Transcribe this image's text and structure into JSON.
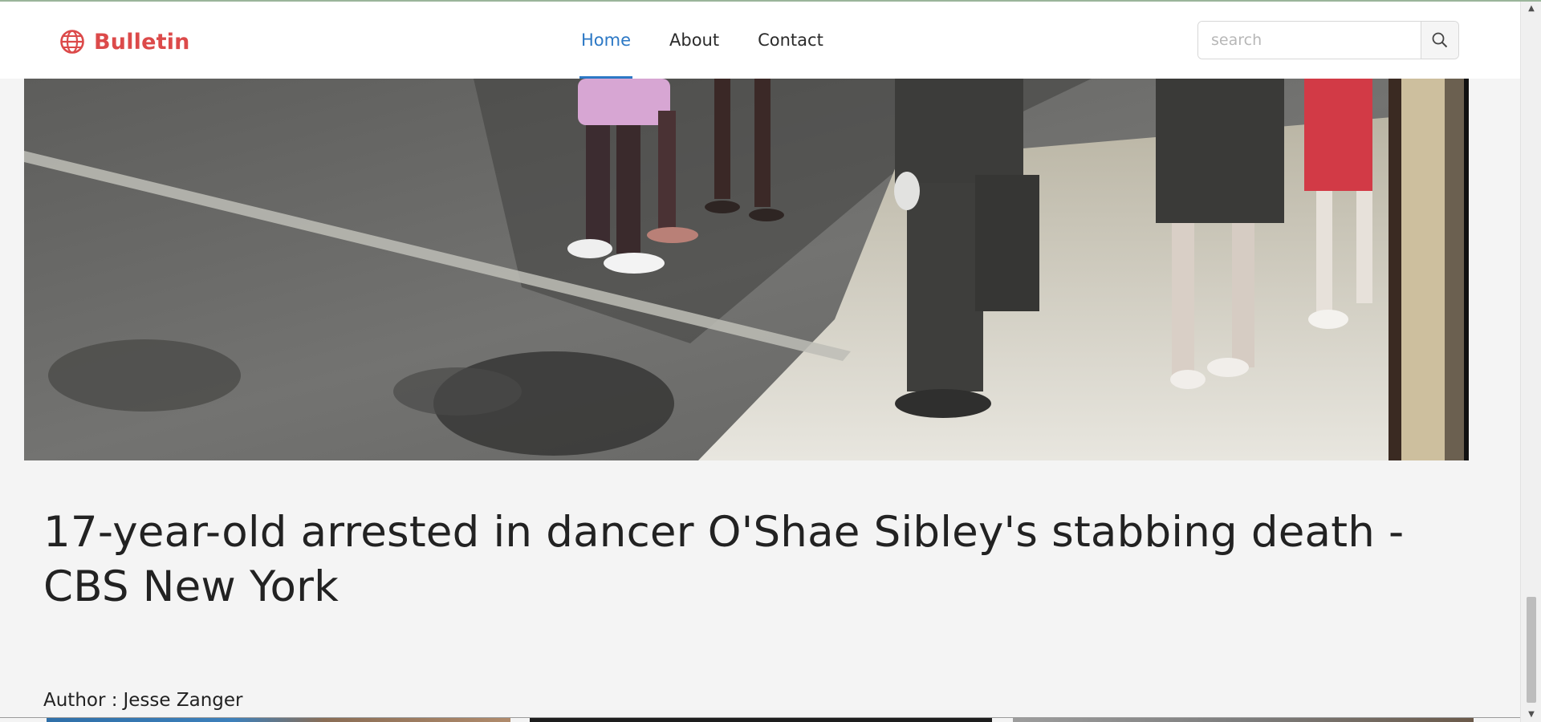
{
  "brand": {
    "name": "Bulletin",
    "icon": "globe-icon",
    "color": "#dc4a4a"
  },
  "nav": {
    "items": [
      {
        "label": "Home",
        "active": true
      },
      {
        "label": "About",
        "active": false
      },
      {
        "label": "Contact",
        "active": false
      }
    ],
    "active_color": "#2c78c5"
  },
  "search": {
    "placeholder": "search",
    "value": "",
    "icon": "magnifier-icon"
  },
  "article": {
    "title": "17-year-old arrested in dancer O'Shae Sibley's stabbing death - CBS New York",
    "author_label": "Author :",
    "author_name": "Jesse Zanger"
  },
  "scrollbar": {
    "up_icon": "triangle-up-icon",
    "down_icon": "triangle-down-icon"
  }
}
